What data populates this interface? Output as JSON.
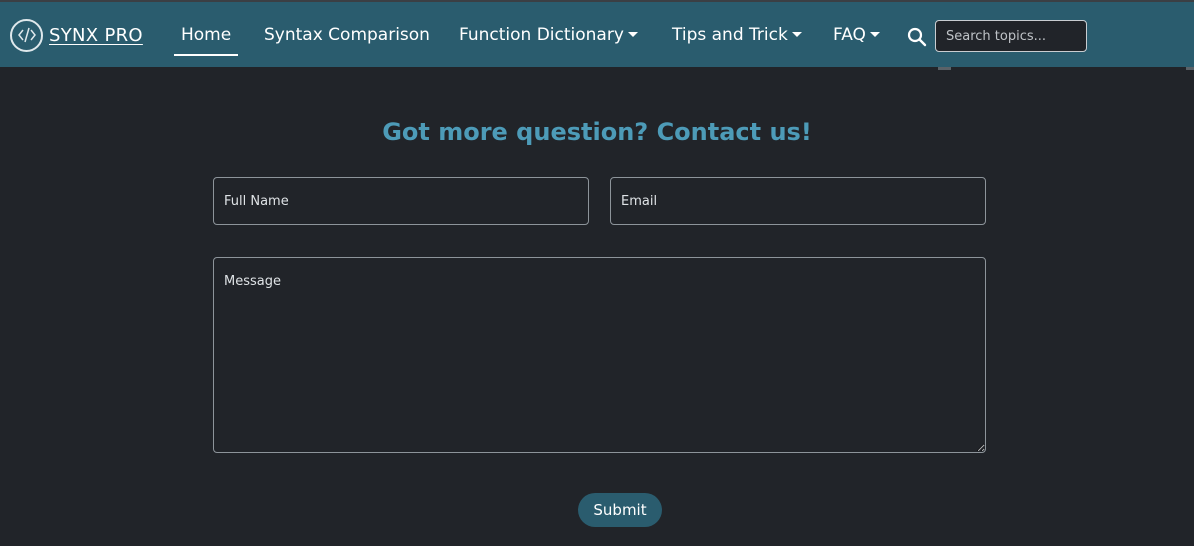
{
  "navbar": {
    "brand_name": "SYNX PRO",
    "brand_logo_icon": "code-brackets-icon",
    "links": [
      {
        "label": "Home",
        "active": true,
        "dropdown": false
      },
      {
        "label": "Syntax Comparison",
        "active": false,
        "dropdown": false
      },
      {
        "label": "Function Dictionary",
        "active": false,
        "dropdown": true
      },
      {
        "label": "Tips and Trick",
        "active": false,
        "dropdown": true
      },
      {
        "label": "FAQ",
        "active": false,
        "dropdown": true
      }
    ],
    "search_icon": "search-icon",
    "search_placeholder": "Search topics..."
  },
  "contact": {
    "title": "Got more question? Contact us!",
    "full_name_placeholder": "Full Name",
    "email_placeholder": "Email",
    "message_placeholder": "Message",
    "submit_label": "Submit"
  },
  "colors": {
    "navbar": "#2a5c6e",
    "background": "#212429",
    "accent_title": "#4d9bb8"
  }
}
